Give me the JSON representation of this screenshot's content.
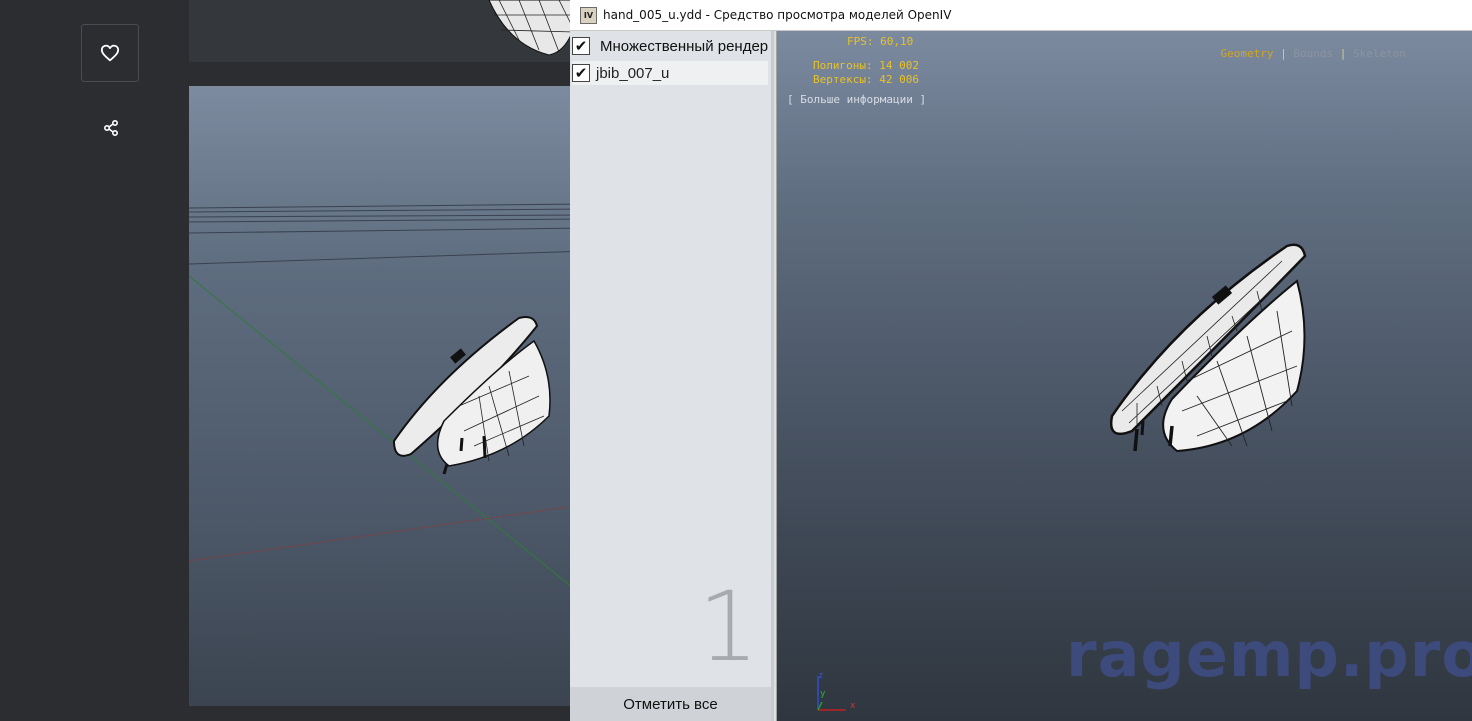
{
  "site": {
    "like_icon": "heart-icon",
    "share_icon": "share-icon"
  },
  "window": {
    "title": "hand_005_u.ydd - Средство просмотра моделей OpenIV",
    "app_icon_text": "IV"
  },
  "model_list": {
    "header_label": "Множественный рендер",
    "items": [
      {
        "label": "jbib_007_u",
        "checked": true
      }
    ],
    "header_checked": true,
    "count": "1",
    "select_all_label": "Отметить все"
  },
  "viewport": {
    "fps": "FPS: 60,10",
    "polygons": "Полигоны: 14 002",
    "vertices": "Вертексы: 42 006",
    "more_info": "[ Больше информации ]",
    "modes": [
      {
        "label": "Geometry",
        "active": true
      },
      {
        "label": "Bounds",
        "active": false
      },
      {
        "label": "Skeleton",
        "active": false
      }
    ],
    "axis_labels": {
      "z": "z",
      "y": "y",
      "x": "x"
    }
  },
  "watermark": "ragemp.pro",
  "colors": {
    "overlay_text": "#e8c228",
    "watermark": "#3e4d86"
  }
}
